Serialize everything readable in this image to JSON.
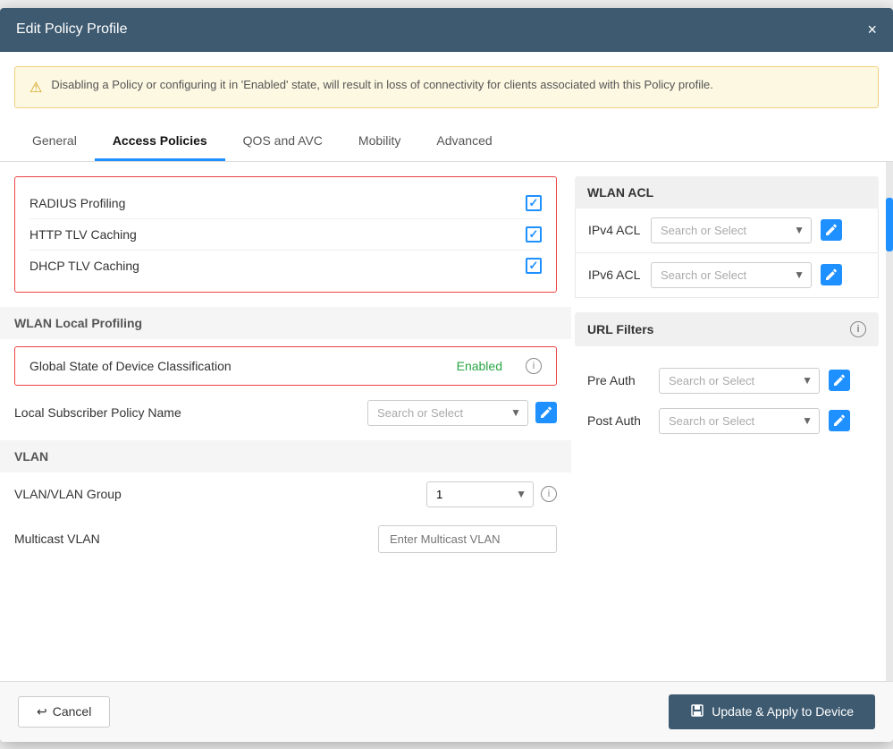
{
  "modal": {
    "title": "Edit Policy Profile",
    "close_label": "×"
  },
  "alert": {
    "text": "Disabling a Policy or configuring it in 'Enabled' state, will result in loss of connectivity for clients associated with this Policy profile."
  },
  "tabs": [
    {
      "label": "General",
      "active": false
    },
    {
      "label": "Access Policies",
      "active": true
    },
    {
      "label": "QOS and AVC",
      "active": false
    },
    {
      "label": "Mobility",
      "active": false
    },
    {
      "label": "Advanced",
      "active": false
    }
  ],
  "left": {
    "radius_profiling_label": "RADIUS Profiling",
    "http_tlv_label": "HTTP TLV Caching",
    "dhcp_tlv_label": "DHCP TLV Caching",
    "wlan_local_profiling_label": "WLAN Local Profiling",
    "global_state_label": "Global State of Device Classification",
    "global_state_value": "Enabled",
    "local_subscriber_label": "Local Subscriber Policy Name",
    "local_subscriber_placeholder": "Search or Select",
    "vlan_label": "VLAN",
    "vlan_group_label": "VLAN/VLAN Group",
    "vlan_value": "1",
    "multicast_vlan_label": "Multicast VLAN",
    "multicast_vlan_placeholder": "Enter Multicast VLAN"
  },
  "right": {
    "wlan_acl_label": "WLAN ACL",
    "ipv4_label": "IPv4 ACL",
    "ipv4_placeholder": "Search or Select",
    "ipv6_label": "IPv6 ACL",
    "ipv6_placeholder": "Search or Select",
    "url_filters_label": "URL Filters",
    "pre_auth_label": "Pre Auth",
    "pre_auth_placeholder": "Search or Select",
    "post_auth_label": "Post Auth",
    "post_auth_placeholder": "Search or Select"
  },
  "footer": {
    "cancel_label": "Cancel",
    "update_label": "Update & Apply to Device"
  }
}
